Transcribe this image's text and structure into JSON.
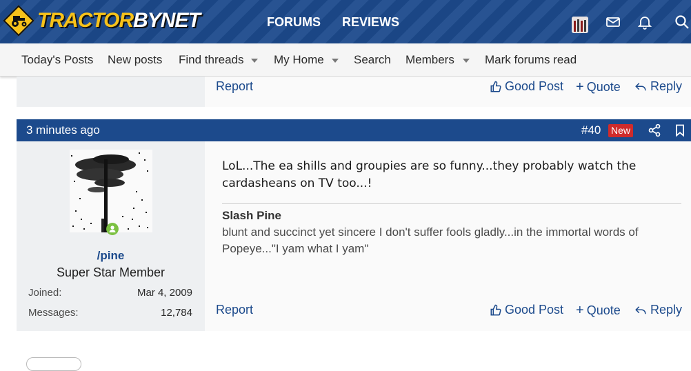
{
  "header": {
    "logo_text_1": "TRACTOR",
    "logo_text_2": "BYNET",
    "nav": [
      "FORUMS",
      "REVIEWS"
    ]
  },
  "subnav": {
    "items": [
      "Today's Posts",
      "New posts",
      "Find threads",
      "My Home",
      "Search",
      "Members",
      "Mark forums read"
    ]
  },
  "prev_post": {
    "report": "Report",
    "good_post": "Good Post",
    "quote": "Quote",
    "reply": "Reply"
  },
  "post": {
    "time": "3 minutes ago",
    "number": "#40",
    "badge": "New",
    "user": {
      "name": "/pine",
      "title": "Super Star Member",
      "joined_label": "Joined:",
      "joined_value": "Mar 4, 2009",
      "messages_label": "Messages:",
      "messages_value": "12,784"
    },
    "message": "LoL...The ea shills and groupies are so funny...they probably watch the cardasheans on TV too...!",
    "signature": {
      "name": "Slash Pine",
      "text": "blunt and succinct yet sincere I don't suffer fools gladly...in the immortal words of Popeye...\"I yam what I yam\""
    },
    "actions": {
      "report": "Report",
      "good_post": "Good Post",
      "quote": "Quote",
      "reply": "Reply"
    }
  },
  "colors": {
    "brand_blue": "#1c4a8c",
    "logo_yellow": "#f7c21a",
    "new_badge": "#cf2b2b",
    "online_green": "#7cc142"
  }
}
